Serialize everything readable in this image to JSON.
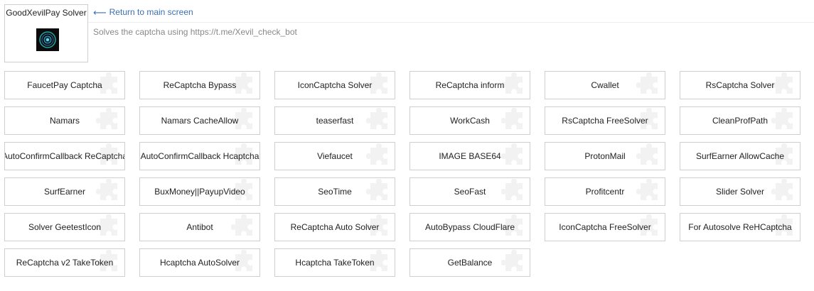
{
  "app": {
    "title": "GoodXevilPay Solver",
    "logo_icon": "xevil-logo-icon"
  },
  "header": {
    "back_label": "Return to main screen",
    "back_icon": "arrow-left-icon",
    "subtitle": "Solves the captcha using https://t.me/Xevil_check_bot"
  },
  "colors": {
    "link": "#3a6fb0",
    "border": "#cfcfcf",
    "subtitle": "#888888"
  },
  "buttons": [
    "FaucetPay Captcha",
    "ReCaptcha Bypass",
    "IconCaptcha Solver",
    "ReCaptcha inform",
    "Cwallet",
    "RsCaptcha Solver",
    "Namars",
    "Namars CacheAllow",
    "teaserfast",
    "WorkCash",
    "RsCaptcha FreeSolver",
    "CleanProfPath",
    "AutoConfirmCallback ReCaptcha",
    "AutoConfirmCallback Hcaptcha",
    "Viefaucet",
    "IMAGE BASE64",
    "ProtonMail",
    "SurfEarner AllowCache",
    "SurfEarner",
    "BuxMoney||PayupVideo",
    "SeoTime",
    "SeoFast",
    "Profitcentr",
    "Slider Solver",
    "Solver GeetestIcon",
    "Antibot",
    "ReCaptcha Auto Solver",
    "AutoBypass CloudFlare",
    "IconCaptcha FreeSolver",
    "For Autosolve ReHCaptcha",
    "ReCaptcha v2 TakeToken",
    "Hcaptcha AutoSolver",
    "Hcaptcha TakeToken",
    "GetBalance"
  ]
}
